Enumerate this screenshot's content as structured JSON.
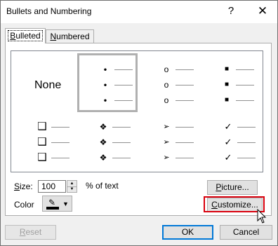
{
  "window": {
    "title": "Bullets and Numbering",
    "help_label": "?",
    "close_label": "✕"
  },
  "tabs": [
    {
      "label": "Bulleted",
      "accel": "B",
      "rest": "ulleted",
      "active": true
    },
    {
      "label": "Numbered",
      "accel": "N",
      "rest": "umbered",
      "active": false
    }
  ],
  "gallery": {
    "none_label": "None",
    "selected_index": 0,
    "bullets": {
      "dot": "•",
      "circle": "o",
      "square": "■",
      "box": "❑",
      "diamond": "❖",
      "arrow": "➢",
      "check": "✓"
    }
  },
  "size": {
    "label": "Size:",
    "accel": "S",
    "rest": "ize:",
    "value": "100",
    "unit": "% of text"
  },
  "color": {
    "label": "Color",
    "swatch_color": "#000000"
  },
  "buttons": {
    "picture": {
      "label": "Picture...",
      "accel": "P",
      "rest": "icture..."
    },
    "customize": {
      "label": "Customize...",
      "accel": "C",
      "rest": "ustomize..."
    },
    "reset": {
      "label": "Reset",
      "accel": "R",
      "rest": "eset"
    },
    "ok": {
      "label": "OK"
    },
    "cancel": {
      "label": "Cancel"
    }
  },
  "colors": {
    "highlight": "#d9000d",
    "default_border": "#0078d7",
    "dialog_bg": "#f0f0f0"
  }
}
